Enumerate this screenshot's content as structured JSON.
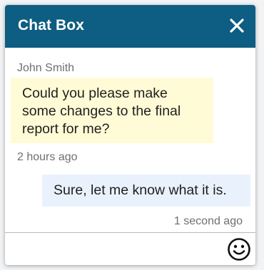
{
  "header": {
    "title": "Chat Box",
    "close_icon": "close-icon",
    "background": "#0e5d82"
  },
  "messages": [
    {
      "direction": "incoming",
      "sender": "John Smith",
      "text": "Could you please make some changes to the final report for me?",
      "time": "2 hours ago",
      "bubble_color": "#fffbd6"
    },
    {
      "direction": "outgoing",
      "text": "Sure, let me know what it is.",
      "time": "1 second ago",
      "bubble_color": "#e9f2fc"
    }
  ],
  "composer": {
    "value": "",
    "placeholder": "",
    "emoji_icon": "smiley-face-icon"
  }
}
